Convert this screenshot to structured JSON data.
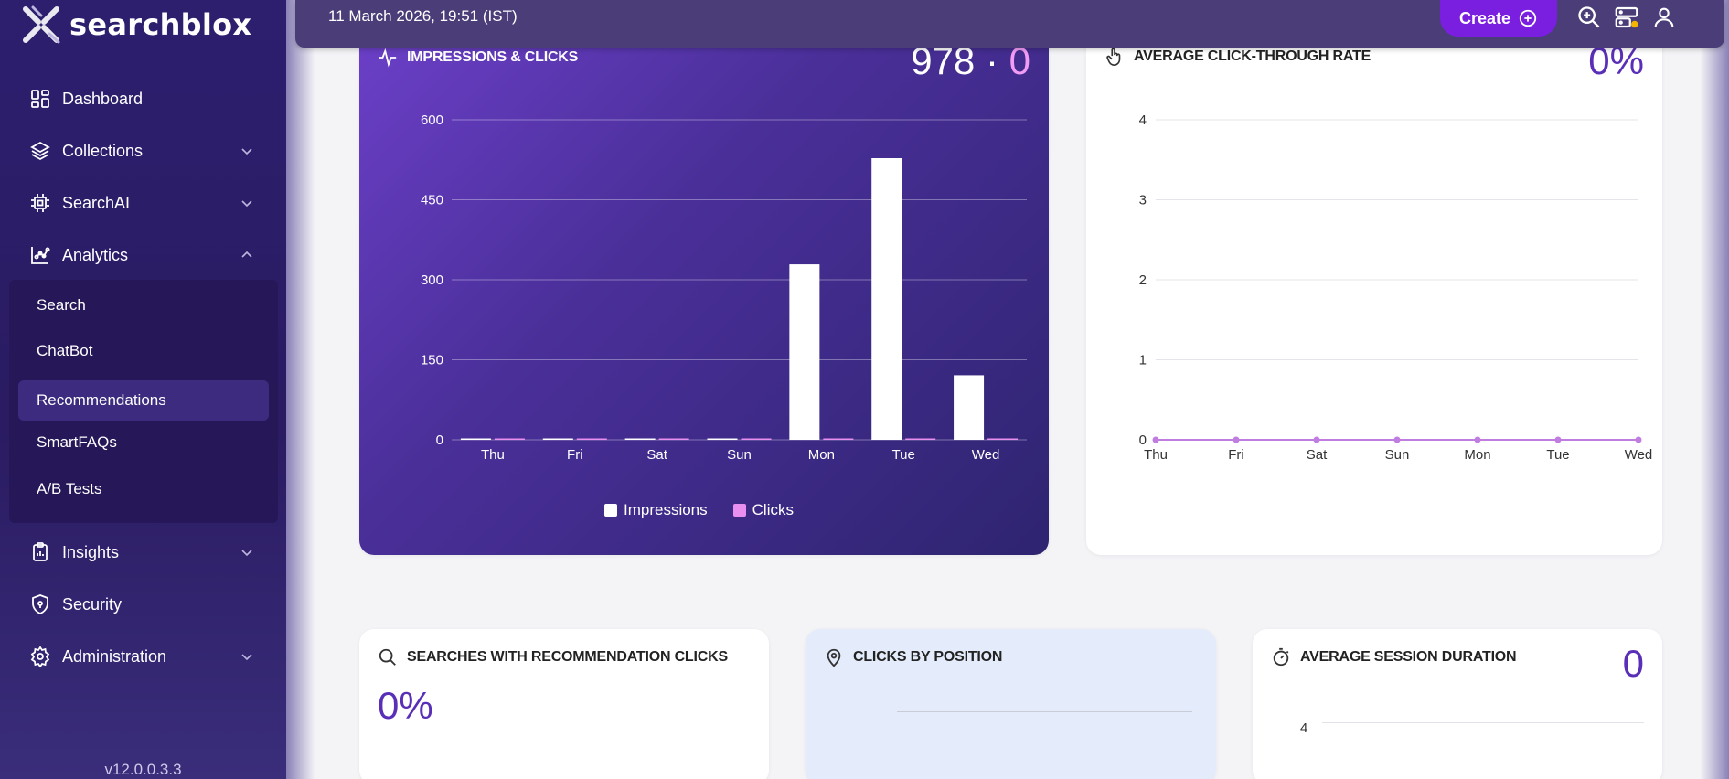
{
  "sidebar": {
    "logo_text": "searchblox",
    "items": [
      {
        "label": "Dashboard",
        "icon": "dashboard-icon"
      },
      {
        "label": "Collections",
        "icon": "layers-icon"
      },
      {
        "label": "SearchAI",
        "icon": "chip-icon"
      },
      {
        "label": "Analytics",
        "icon": "analytics-icon"
      },
      {
        "label": "Insights",
        "icon": "clipboard-icon"
      },
      {
        "label": "Security",
        "icon": "shield-icon"
      },
      {
        "label": "Administration",
        "icon": "gear-icon"
      }
    ],
    "analytics_sub": [
      "Search",
      "ChatBot",
      "Recommendations",
      "SmartFAQs",
      "A/B Tests"
    ],
    "active_sub": "Recommendations",
    "version": "v12.0.0.3.3"
  },
  "topbar": {
    "datetime": "11 March 2026, 19:51 (IST)",
    "create_label": "Create"
  },
  "impressions_card": {
    "title": "IMPRESSIONS & CLICKS",
    "stat_impressions": "978",
    "stat_separator": "·",
    "stat_clicks": "0",
    "legend_impressions": "Impressions",
    "legend_clicks": "Clicks"
  },
  "ctr_card": {
    "title": "AVERAGE CLICK-THROUGH RATE",
    "stat": "0%"
  },
  "searches_card": {
    "title": "SEARCHES WITH RECOMMENDATION CLICKS",
    "stat": "0%"
  },
  "position_card": {
    "title": "CLICKS BY POSITION"
  },
  "session_card": {
    "title": "AVERAGE SESSION DURATION",
    "stat": "0",
    "tick": "4"
  },
  "colors": {
    "accent": "#7a1fe0",
    "clicks": "#e88ff0",
    "stat_purple": "#5a2fb8"
  },
  "chart_data": [
    {
      "type": "bar",
      "categories": [
        "Thu",
        "Fri",
        "Sat",
        "Sun",
        "Mon",
        "Tue",
        "Wed"
      ],
      "series": [
        {
          "name": "Impressions",
          "values": [
            0,
            0,
            0,
            0,
            329,
            528,
            121
          ]
        },
        {
          "name": "Clicks",
          "values": [
            0,
            0,
            0,
            0,
            0,
            0,
            0
          ]
        }
      ],
      "yticks": [
        "0",
        "150",
        "300",
        "450",
        "600"
      ],
      "ylim": [
        0,
        600
      ],
      "legend": "bottom",
      "grid": true
    },
    {
      "type": "line",
      "categories": [
        "Thu",
        "Fri",
        "Sat",
        "Sun",
        "Mon",
        "Tue",
        "Wed"
      ],
      "series": [
        {
          "values": [
            0,
            0,
            0,
            0,
            0,
            0,
            0
          ]
        }
      ],
      "yticks": [
        "0",
        "1",
        "2",
        "3",
        "4"
      ],
      "ylim": [
        0,
        4
      ],
      "grid": true
    }
  ]
}
